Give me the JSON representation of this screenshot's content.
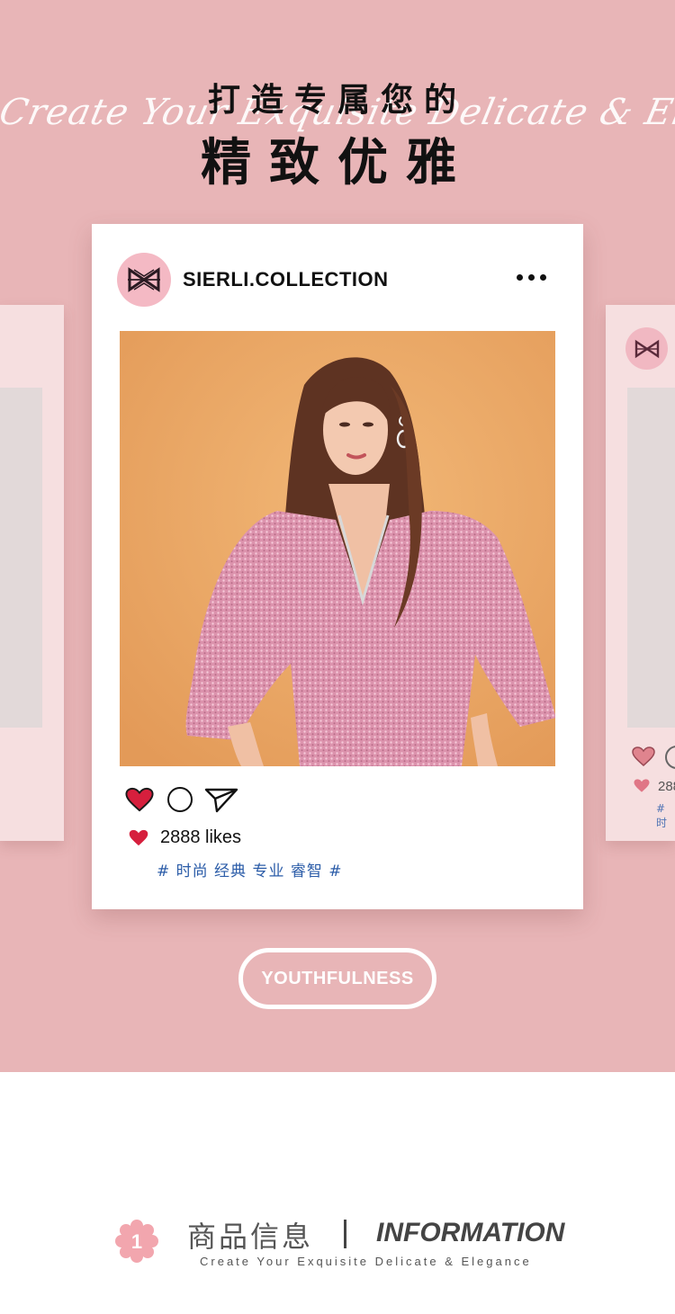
{
  "hero": {
    "script_text": "Create Your Exquisite Delicate & Elegance",
    "title_line1": "打造专属您的",
    "title_line2": "精致优雅"
  },
  "post": {
    "username": "SIERLI.COLLECTION",
    "likes": "2888 likes",
    "tags": "# 时尚 经典 专业 睿智 #",
    "like_color": "#d61f3d"
  },
  "side_right": {
    "likes_partial": "288",
    "tags_partial": "# 时"
  },
  "badge": {
    "label": "YOUTHFULNESS"
  },
  "info": {
    "number": "1",
    "title_cn": "商品信息",
    "title_en": "INFORMATION",
    "subtitle": "Create Your Exquisite Delicate & Elegance"
  },
  "colors": {
    "background_pink": "#e8b5b7",
    "card_side": "#f6dfe0",
    "tag_blue": "#2b5ca8"
  }
}
